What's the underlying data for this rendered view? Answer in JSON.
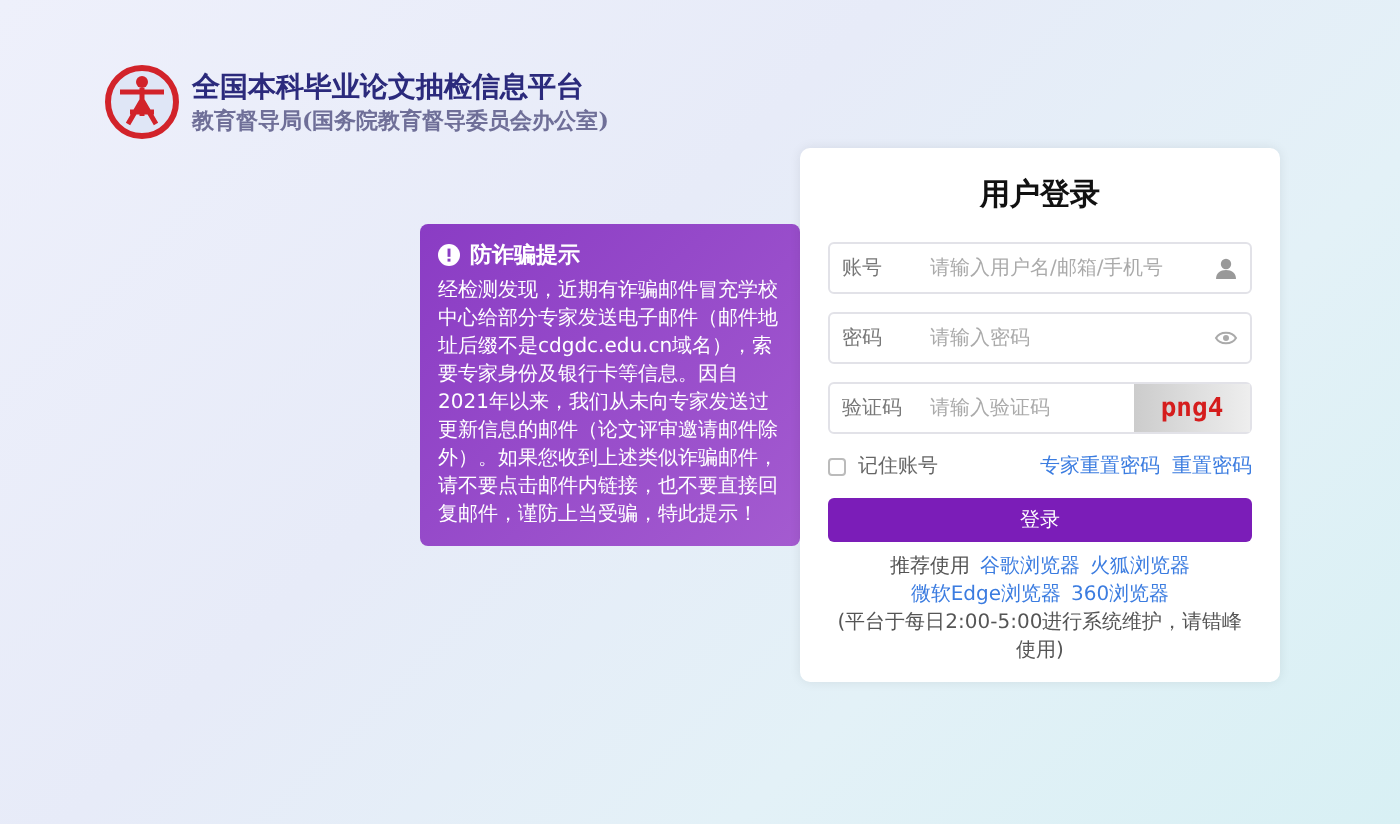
{
  "header": {
    "title": "全国本科毕业论文抽检信息平台",
    "subtitle": "教育督导局(国务院教育督导委员会办公室)"
  },
  "notice": {
    "title": "防诈骗提示",
    "text": "经检测发现，近期有诈骗邮件冒充学校中心给部分专家发送电子邮件（邮件地址后缀不是cdgdc.edu.cn域名），索要专家身份及银行卡等信息。因自2021年以来，我们从未向专家发送过更新信息的邮件（论文评审邀请邮件除外）。如果您收到上述类似诈骗邮件，请不要点击邮件内链接，也不要直接回复邮件，谨防上当受骗，特此提示！"
  },
  "login": {
    "title": "用户登录",
    "fields": [
      {
        "kind": "account",
        "label": "账号",
        "placeholder": "请输入用户名/邮箱/手机号"
      },
      {
        "kind": "password",
        "label": "密码",
        "placeholder": "请输入密码"
      },
      {
        "kind": "captcha",
        "label": "验证码",
        "placeholder": "请输入验证码",
        "captcha": "png4"
      }
    ],
    "remember": {
      "label": "记住账号",
      "checked": false
    },
    "links": [
      "专家重置密码",
      "重置密码"
    ],
    "submit": "登录",
    "browsers": {
      "prefix": "推荐使用",
      "links": [
        "谷歌浏览器",
        "火狐浏览器",
        "微软Edge浏览器",
        "360浏览器"
      ],
      "note": "(平台于每日2:00-5:00进行系统维护，请错峰使用)"
    }
  }
}
